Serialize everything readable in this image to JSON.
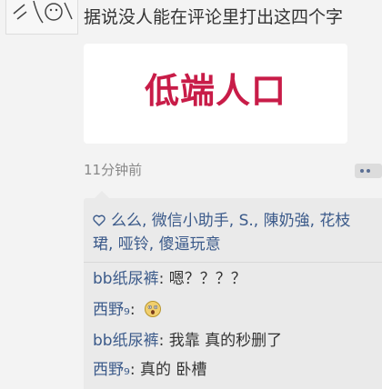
{
  "post": {
    "title": "据说没人能在评论里打出这四个字",
    "image_text": "低端人口",
    "timestamp": "11分钟前"
  },
  "likes": {
    "line1": "么么, 微信小助手, S., 陳奶強, 花枝",
    "line2": "珺, 哑铃, 傻逼玩意"
  },
  "comments": [
    {
      "name": "bb纸尿裤",
      "sep": ": ",
      "text": "嗯？？？？"
    },
    {
      "name": "西野₉",
      "sep": ": ",
      "text": ""
    },
    {
      "name": "bb纸尿裤",
      "sep": ": ",
      "text": "我靠 真的秒删了"
    },
    {
      "name": "西野₉",
      "sep": ": ",
      "text": "真的 卧槽"
    }
  ],
  "colors": {
    "name_blue": "#3b5a8a",
    "image_text_red": "#c81c48",
    "comment_bg": "#eaeaea"
  },
  "icons": {
    "heart": "heart-outline-icon",
    "emoji": "surprised-face-emoji-icon",
    "more": "more-dots-icon"
  }
}
